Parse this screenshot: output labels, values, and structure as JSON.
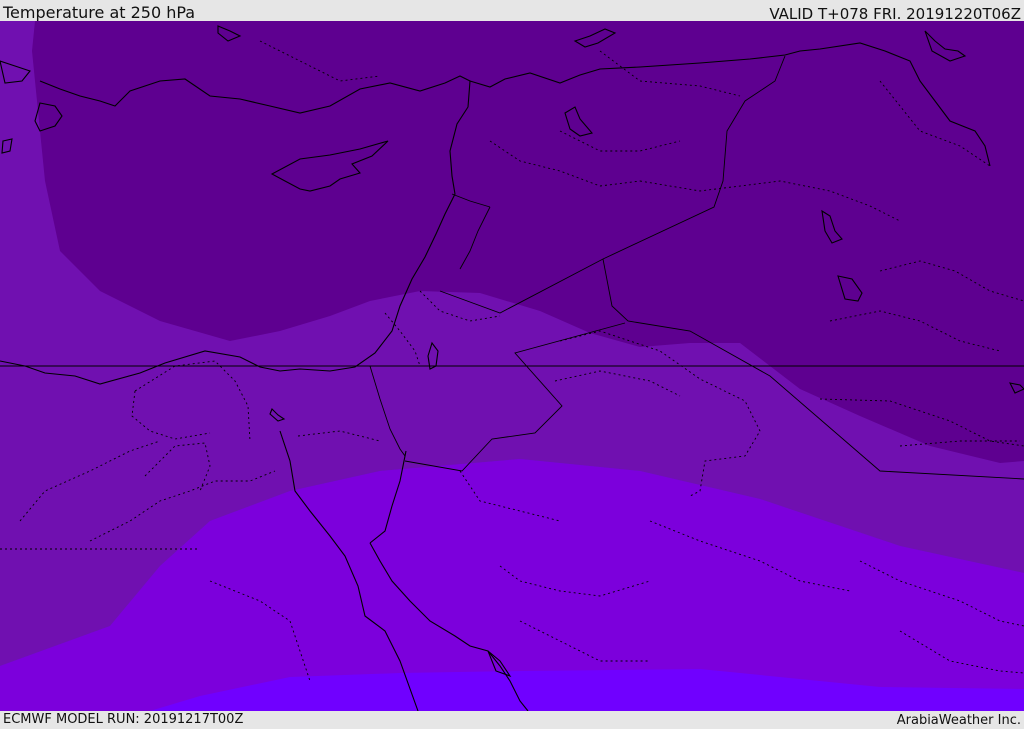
{
  "header": {
    "title": "Temperature at 250 hPa",
    "valid": "VALID T+078 FRI. 20191220T06Z"
  },
  "footer": {
    "model_run": "ECMWF MODEL RUN: 20191217T00Z",
    "credit": "ArabiaWeather Inc."
  },
  "colors": {
    "band_coldest": "#5e0090",
    "band_cold": "#7010b0",
    "band_mid": "#7c00dc",
    "band_warm": "#7000ff",
    "coastline": "#000000",
    "border": "#000000"
  }
}
